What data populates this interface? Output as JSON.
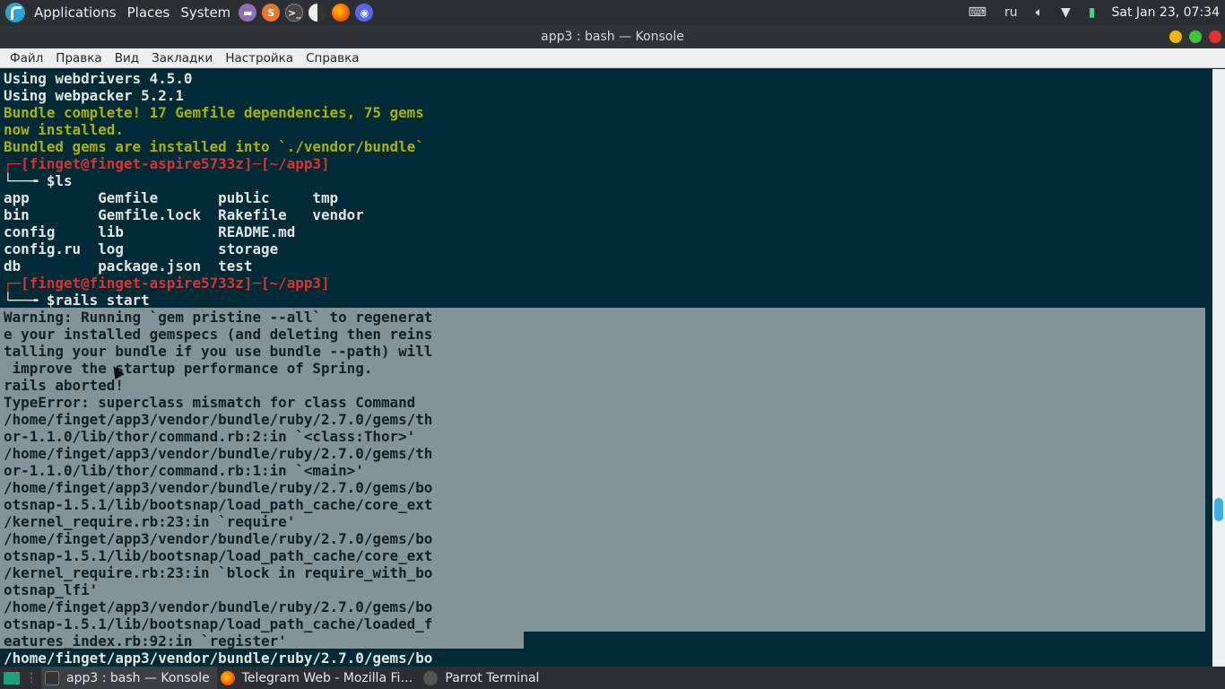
{
  "top_panel": {
    "menus": [
      "Applications",
      "Places",
      "System"
    ],
    "keyboard_layout": "ru",
    "clock": "Sat Jan 23, 07:34"
  },
  "window": {
    "title": "app3 : bash — Konsole"
  },
  "menubar": [
    "Файл",
    "Правка",
    "Вид",
    "Закладки",
    "Настройка",
    "Справка"
  ],
  "terminal": {
    "lines": [
      "Using webdrivers 4.5.0",
      "Using webpacker 5.2.1",
      "Bundle complete! 17 Gemfile dependencies, 75 gems",
      "now installed.",
      "Bundled gems are installed into `./vendor/bundle`",
      "┌─[finget@finget-aspire5733z]─[~/app3]",
      "└──╼ $ls",
      "app        Gemfile       public     tmp",
      "bin        Gemfile.lock  Rakefile   vendor",
      "config     lib           README.md",
      "config.ru  log           storage",
      "db         package.json  test",
      "┌─[finget@finget-aspire5733z]─[~/app3]",
      "└──╼ $rails start",
      "Warning: Running `gem pristine --all` to regenerat",
      "e your installed gemspecs (and deleting then reins",
      "talling your bundle if you use bundle --path) will",
      " improve the startup performance of Spring.",
      "rails aborted!",
      "TypeError: superclass mismatch for class Command",
      "/home/finget/app3/vendor/bundle/ruby/2.7.0/gems/th",
      "or-1.1.0/lib/thor/command.rb:2:in `<class:Thor>'",
      "/home/finget/app3/vendor/bundle/ruby/2.7.0/gems/th",
      "or-1.1.0/lib/thor/command.rb:1:in `<main>'",
      "/home/finget/app3/vendor/bundle/ruby/2.7.0/gems/bo",
      "otsnap-1.5.1/lib/bootsnap/load_path_cache/core_ext",
      "/kernel_require.rb:23:in `require'",
      "/home/finget/app3/vendor/bundle/ruby/2.7.0/gems/bo",
      "otsnap-1.5.1/lib/bootsnap/load_path_cache/core_ext",
      "/kernel_require.rb:23:in `block in require_with_bo",
      "otsnap_lfi'",
      "/home/finget/app3/vendor/bundle/ruby/2.7.0/gems/bo",
      "otsnap-1.5.1/lib/bootsnap/load_path_cache/loaded_f",
      "eatures_index.rb:92:in `register'",
      "/home/finget/app3/vendor/bundle/ruby/2.7.0/gems/bo"
    ]
  },
  "taskbar": {
    "tasks": [
      "app3 : bash — Konsole",
      "Telegram Web - Mozilla Fi…",
      "Parrot Terminal"
    ]
  },
  "colors": {
    "terminal_bg": "#002b36",
    "selection_bg": "#839496",
    "prompt_red": "#dc322f",
    "bundle_green": "#a8b300",
    "scroll_accent": "#3daee9"
  }
}
